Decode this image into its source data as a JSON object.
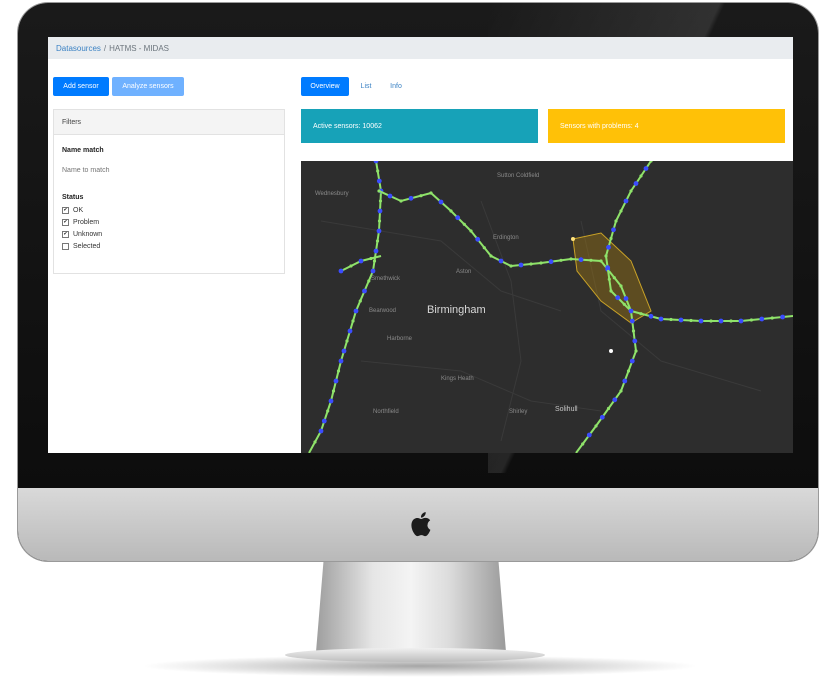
{
  "breadcrumb": {
    "root": "Datasources",
    "separator": "/",
    "current": "HATMS - MIDAS"
  },
  "toolbar": {
    "add_label": "Add sensor",
    "analyze_label": "Analyze sensors"
  },
  "filters": {
    "header": "Filters",
    "name_match_title": "Name match",
    "name_match_placeholder": "Name to match",
    "status_title": "Status",
    "statuses": [
      {
        "label": "OK",
        "checked": true
      },
      {
        "label": "Problem",
        "checked": true
      },
      {
        "label": "Unknown",
        "checked": true
      },
      {
        "label": "Selected",
        "checked": false
      }
    ]
  },
  "tabs": [
    {
      "label": "Overview",
      "active": true
    },
    {
      "label": "List",
      "active": false
    },
    {
      "label": "Info",
      "active": false
    }
  ],
  "stats": {
    "active": "Active sensors: 10062",
    "problems": "Sensors with problems: 4"
  },
  "map": {
    "labels": {
      "birmingham": "Birmingham",
      "sutton": "Sutton Coldfield",
      "wednesbury": "Wednesbury",
      "erdington": "Erdington",
      "aston": "Aston",
      "smethwick": "Smethwick",
      "bearwood": "Bearwood",
      "harborne": "Harborne",
      "kings_heath": "Kings Heath",
      "northfield": "Northfield",
      "shirley": "Shirley",
      "solihull": "Solihull"
    }
  },
  "colors": {
    "primary": "#007bff",
    "primary_light": "#6fb1ff",
    "info": "#17a2b8",
    "warning": "#ffc107",
    "map_bg": "#2d2d2d",
    "sensor_ok": "#8fe36a",
    "sensor_marker": "#3b4cff"
  }
}
